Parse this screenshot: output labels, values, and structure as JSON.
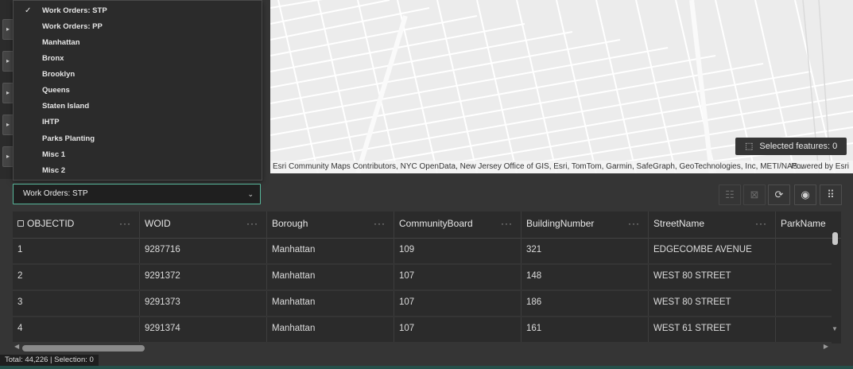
{
  "map": {
    "attribution": "Esri Community Maps Contributors, NYC OpenData, New Jersey Office of GIS, Esri, TomTom, Garmin, SafeGraph, GeoTechnologies, Inc, METI/NAS...",
    "powered_by": "Powered by Esri",
    "selected_features": "Selected features: 0"
  },
  "layer_menu": {
    "items": [
      {
        "label": "Work Orders: STP",
        "checked": true
      },
      {
        "label": "Work Orders: PP",
        "checked": false
      },
      {
        "label": "Manhattan",
        "checked": false
      },
      {
        "label": "Bronx",
        "checked": false
      },
      {
        "label": "Brooklyn",
        "checked": false
      },
      {
        "label": "Queens",
        "checked": false
      },
      {
        "label": "Staten Island",
        "checked": false
      },
      {
        "label": "IHTP",
        "checked": false
      },
      {
        "label": "Parks Planting",
        "checked": false
      },
      {
        "label": "Misc 1",
        "checked": false
      },
      {
        "label": "Misc 2",
        "checked": false
      }
    ],
    "check_glyph": "✓"
  },
  "select": {
    "value": "Work Orders: STP"
  },
  "toolbar": {
    "icons": [
      "show-selected-icon",
      "clear-selection-icon",
      "refresh-icon",
      "toggle-columns-icon",
      "grid-menu-icon"
    ]
  },
  "table": {
    "columns": [
      "OBJECTID",
      "WOID",
      "Borough",
      "CommunityBoard",
      "BuildingNumber",
      "StreetName",
      "ParkName"
    ],
    "menu_glyph": "···",
    "rows": [
      [
        "1",
        "9287716",
        "Manhattan",
        "109",
        "321",
        "EDGECOMBE AVENUE",
        ""
      ],
      [
        "2",
        "9291372",
        "Manhattan",
        "107",
        "148",
        "WEST 80 STREET",
        ""
      ],
      [
        "3",
        "9291373",
        "Manhattan",
        "107",
        "186",
        "WEST 80 STREET",
        ""
      ],
      [
        "4",
        "9291374",
        "Manhattan",
        "107",
        "161",
        "WEST 61 STREET",
        ""
      ]
    ]
  },
  "status": {
    "text": "Total: 44,226 | Selection: 0"
  },
  "colors": {
    "accent": "#58b79b",
    "panel": "#353535",
    "map_background": "#ececec"
  }
}
